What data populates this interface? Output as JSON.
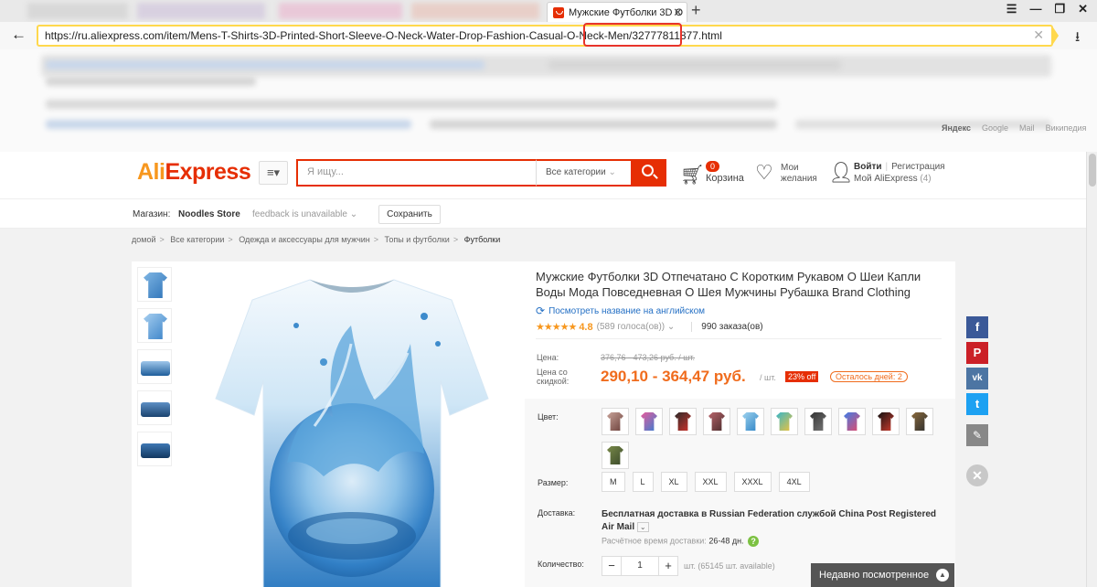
{
  "browser": {
    "active_tab_title": "Мужские Футболки 3D О",
    "tab_close": "✕",
    "new_tab": "+",
    "win_controls": [
      "☰",
      "—",
      "❐",
      "✕"
    ],
    "url": "https://ru.aliexpress.com/item/Mens-T-Shirts-3D-Printed-Short-Sleeve-O-Neck-Water-Drop-Fashion-Casual-O-Neck-Men/32777811877.html",
    "url_clear": "✕",
    "search_engines": [
      "Яндекс",
      "Google",
      "Mail",
      "Википедия"
    ],
    "accent": "#ffd84d",
    "highlight_color": "#e8332a"
  },
  "header": {
    "logo_part1": "Ali",
    "logo_part2": "Express",
    "menu_icon": "≡▾",
    "search_placeholder": "Я ищу...",
    "category_select": "Все категории",
    "cart_count": "0",
    "cart_label": "Корзина",
    "wishlist_label": "Мои желания",
    "login": "Войти",
    "register": "Регистрация",
    "my_account": "Мой AliExpress",
    "my_account_count": "(4)"
  },
  "store": {
    "label": "Магазин:",
    "name": "Noodles Store",
    "feedback": "feedback is unavailable",
    "save_label": "Сохранить"
  },
  "breadcrumb": [
    "домой",
    "Все категории",
    "Одежда и аксессуары для мужчин",
    "Топы и футболки",
    "Футболки"
  ],
  "product": {
    "title": "Мужские Футболки 3D Отпечатано С Коротким Рукавом О Шеи Капли Воды Мода Повседневная О Шея Мужчины Рубашка Brand Clothing",
    "translate_link": "Посмотреть название на английском",
    "stars": "★★★★★",
    "rating": "4.8",
    "votes": "(589 голоса(ов))",
    "orders": "990 заказа(ов)",
    "price_old_label": "Цена:",
    "price_old": "376,76 - 473,26 руб. / шт.",
    "price_label": "Цена со скидкой:",
    "price_new": "290,10 - 364,47 руб.",
    "price_unit": "/ шт.",
    "discount": "23% off",
    "days_left": "Осталось дней: 2",
    "color_label": "Цвет:",
    "size_label": "Размер:",
    "sizes": [
      "M",
      "L",
      "XL",
      "XXL",
      "XXXL",
      "4XL"
    ],
    "shipping_label": "Доставка:",
    "shipping_text": "Бесплатная доставка в Russian Federation службой China Post Registered Air Mail",
    "ship_time_label": "Расчётное время доставки:",
    "ship_time_value": "26-48 дн.",
    "qty_label": "Количество:",
    "qty_value": "1",
    "qty_note": "шт. (65145 шт. available)"
  },
  "swatch_colors": [
    [
      "#c9a49a",
      "#6b3f3a"
    ],
    [
      "#e85a9b",
      "#3c7fd1"
    ],
    [
      "#2a2a2a",
      "#d2332c"
    ],
    [
      "#b8646b",
      "#4a2c2c"
    ],
    [
      "#9fd3ee",
      "#2e84c6"
    ],
    [
      "#38b6c8",
      "#f0c23b"
    ],
    [
      "#333333",
      "#777777"
    ],
    [
      "#3f7ee8",
      "#e44a6a"
    ],
    [
      "#111111",
      "#d13d2f"
    ],
    [
      "#8a6a3c",
      "#2f2f2f"
    ],
    [
      "#7a8a4a",
      "#3a4a2a"
    ]
  ],
  "social": {
    "facebook": "f",
    "pinterest": "P",
    "vk": "vk",
    "twitter": "t",
    "edit": "✎",
    "close": "✕"
  },
  "recently_viewed": "Недавно посмотренное",
  "recently_chevron": "▲"
}
